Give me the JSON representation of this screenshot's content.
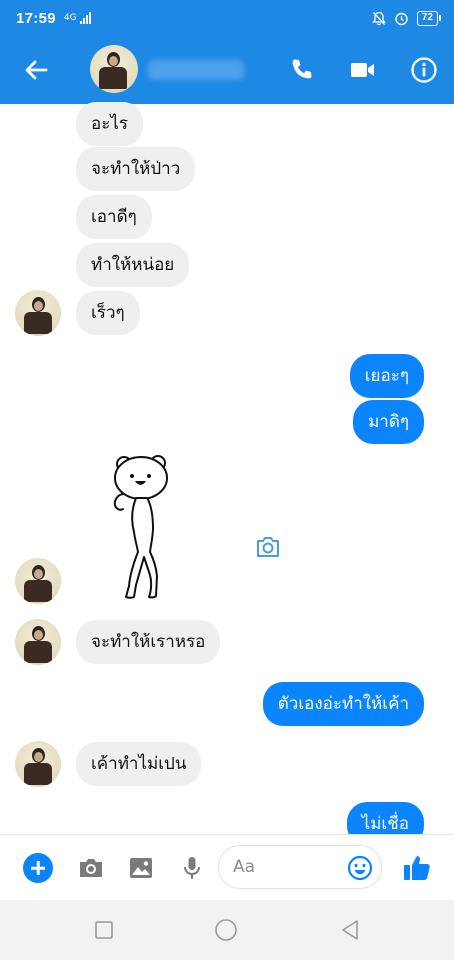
{
  "status_bar": {
    "time": "17:59",
    "network": "4G",
    "battery": "72"
  },
  "header": {
    "back_icon": "arrow-left-icon",
    "call_icon": "phone-icon",
    "video_icon": "video-camera-icon",
    "info_icon": "info-icon"
  },
  "messages": [
    {
      "from": "them",
      "text": "อะไร"
    },
    {
      "from": "them",
      "text": "จะทำให้ป่าว"
    },
    {
      "from": "them",
      "text": "เอาดีๆ"
    },
    {
      "from": "them",
      "text": "ทำให้หน่อย"
    },
    {
      "from": "them",
      "text": "เร็วๆ"
    },
    {
      "from": "me",
      "text": "เยอะๆ"
    },
    {
      "from": "me",
      "text": "มาดิๆ"
    },
    {
      "from": "them",
      "sticker": "bear-sticker"
    },
    {
      "from": "them",
      "text": "จะทำให้เราหรอ"
    },
    {
      "from": "me",
      "text": "ตัวเองอ่ะทำให้เค้า"
    },
    {
      "from": "them",
      "text": "เค้าทำไม่เปน"
    },
    {
      "from": "me",
      "text": "ไม่เชื่อ"
    }
  ],
  "composer": {
    "placeholder": "Aa",
    "icons": [
      "plus-icon",
      "camera-icon",
      "gallery-icon",
      "microphone-icon",
      "emoji-icon",
      "thumbs-up-icon"
    ]
  },
  "colors": {
    "header_blue": "#1e88e5",
    "outgoing_bubble": "#0a84ff",
    "incoming_bubble": "#efefef"
  }
}
